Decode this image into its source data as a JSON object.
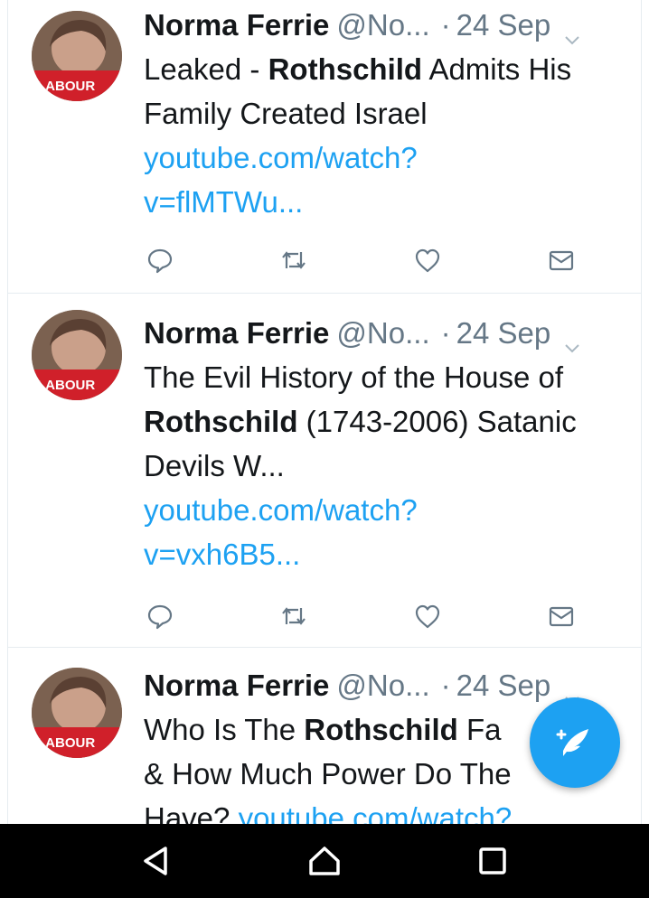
{
  "tweets": [
    {
      "name": "Norma Ferrie",
      "handle": "@No...",
      "dot": "·",
      "date": "24 Sep",
      "text_parts": [
        "Leaked - ",
        "Rothschild",
        " Admits His Family Created Israel"
      ],
      "link_lines": [
        "youtube.com/watch?",
        "v=flMTWu..."
      ]
    },
    {
      "name": "Norma Ferrie",
      "handle": "@No...",
      "dot": "·",
      "date": "24 Sep",
      "text_parts": [
        "The Evil History of the House of ",
        "Rothschild",
        " (1743-2006) Satanic Devils W..."
      ],
      "link_lines": [
        "youtube.com/watch?",
        "v=vxh6B5..."
      ]
    },
    {
      "name": "Norma Ferrie",
      "handle": "@No...",
      "dot": "·",
      "date": "24 Sep",
      "text_parts": [
        "Who Is The ",
        "Rothschild",
        " Fa",
        "& How Much Power Do The",
        " Have? "
      ],
      "link_lines": [
        "youtube.com/watch?"
      ]
    }
  ],
  "avatar_badge": "LABOUR",
  "icons": {
    "reply": "reply-icon",
    "retweet": "retweet-icon",
    "like": "heart-icon",
    "dm": "envelope-icon",
    "compose": "compose-tweet-icon",
    "back": "back-triangle-icon",
    "home": "home-icon",
    "recents": "recents-square-icon"
  },
  "colors": {
    "link": "#1da1f2",
    "accent": "#1da1f2",
    "muted": "#657786",
    "text": "#14171a",
    "navbar": "#000000"
  }
}
